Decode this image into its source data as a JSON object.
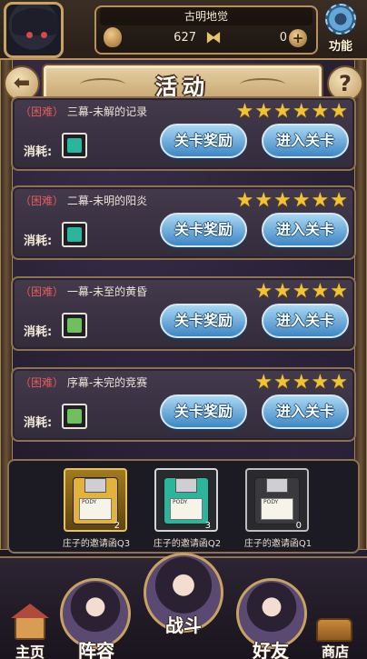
{
  "header": {
    "player_name": "古明地觉",
    "currency_amount": "627",
    "secondary_amount": "0",
    "function_label": "功能",
    "icons": [
      "coin-bag-icon",
      "butterfly-icon",
      "plus-icon",
      "gear-icon"
    ]
  },
  "title": {
    "text": "活动"
  },
  "stages": [
    {
      "difficulty": "（困难）",
      "name": "三幕-未解的记录",
      "stars": "★★★★★★",
      "cost_label": "消耗:",
      "item_color": "#2bb59c",
      "reward_button": "关卡奖励",
      "enter_button": "进入关卡"
    },
    {
      "difficulty": "（困难）",
      "name": "二幕-未明的阳炎",
      "stars": "★★★★★★",
      "cost_label": "消耗:",
      "item_color": "#2bb59c",
      "reward_button": "关卡奖励",
      "enter_button": "进入关卡"
    },
    {
      "difficulty": "（困难）",
      "name": "一幕-未至的黄昏",
      "stars": "★★★★★",
      "cost_label": "消耗:",
      "item_color": "#6fbf5e",
      "reward_button": "关卡奖励",
      "enter_button": "进入关卡"
    },
    {
      "difficulty": "（困难）",
      "name": "序幕-未完的竞赛",
      "stars": "★★★★★",
      "cost_label": "消耗:",
      "item_color": "#6fbf5e",
      "reward_button": "关卡奖励",
      "enter_button": "进入关卡"
    }
  ],
  "items": [
    {
      "name": "庄子的邀请函Q3",
      "count": "2",
      "label_text": "PODY",
      "color": "#e3b23c",
      "frame": "#e6c15c"
    },
    {
      "name": "庄子的邀请函Q2",
      "count": "3",
      "label_text": "PODY",
      "color": "#2bb59c",
      "frame": "#cfd8d6"
    },
    {
      "name": "庄子的邀请函Q1",
      "count": "0",
      "label_text": "PODY",
      "color": "#3a3a3e",
      "frame": "#bdbdbd"
    }
  ],
  "nav": {
    "home": "主页",
    "lineup": "阵容",
    "battle": "战斗",
    "friends": "好友",
    "shop": "商店"
  }
}
